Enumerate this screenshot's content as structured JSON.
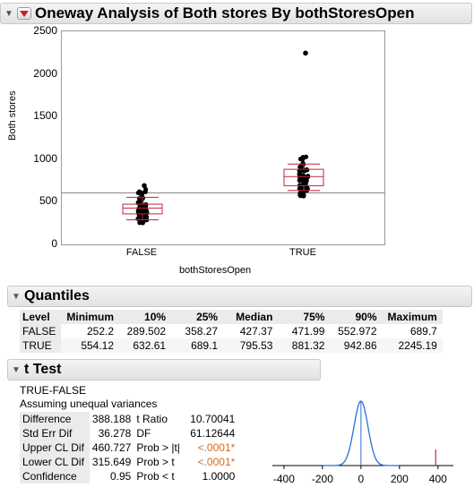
{
  "window": {
    "title": "Oneway Analysis of Both stores By bothStoresOpen"
  },
  "chart_data": {
    "type": "box",
    "title": "",
    "ylabel": "Both stores",
    "xlabel": "bothStoresOpen",
    "ylim": [
      0,
      2500
    ],
    "yticks": [
      "0",
      "500",
      "1000",
      "1500",
      "2000",
      "2500"
    ],
    "categories": [
      "FALSE",
      "TRUE"
    ],
    "grand_mean": 605,
    "boxes": [
      {
        "name": "FALSE",
        "min": 252.2,
        "q10": 289.502,
        "q1": 358.27,
        "median": 427.37,
        "q3": 471.99,
        "q90": 552.972,
        "max": 689.7
      },
      {
        "name": "TRUE",
        "min": 554.12,
        "q10": 632.61,
        "q1": 689.1,
        "median": 795.53,
        "q3": 881.32,
        "q90": 942.86,
        "max": 2245.19
      }
    ],
    "colors": {
      "box": "#c0283c",
      "points": "#000000",
      "mean_line": "#808080"
    }
  },
  "quantiles": {
    "title": "Quantiles",
    "headers": [
      "Level",
      "Minimum",
      "10%",
      "25%",
      "Median",
      "75%",
      "90%",
      "Maximum"
    ],
    "rows": [
      [
        "FALSE",
        "252.2",
        "289.502",
        "358.27",
        "427.37",
        "471.99",
        "552.972",
        "689.7"
      ],
      [
        "TRUE",
        "554.12",
        "632.61",
        "689.1",
        "795.53",
        "881.32",
        "942.86",
        "2245.19"
      ]
    ]
  },
  "ttest": {
    "title": "t Test",
    "comparison": "TRUE-FALSE",
    "assumption": "Assuming unequal variances",
    "rows": [
      {
        "label": "Difference",
        "value": "388.188",
        "label2": "t Ratio",
        "value2": "10.70041",
        "highlight": false
      },
      {
        "label": "Std Err Dif",
        "value": "36.278",
        "label2": "DF",
        "value2": "61.12644",
        "highlight": false
      },
      {
        "label": "Upper CL Dif",
        "value": "460.727",
        "label2": "Prob > |t|",
        "value2": "<.0001*",
        "highlight": true
      },
      {
        "label": "Lower CL Dif",
        "value": "315.649",
        "label2": "Prob > t",
        "value2": "<.0001*",
        "highlight": true
      },
      {
        "label": "Confidence",
        "value": "0.95",
        "label2": "Prob < t",
        "value2": "1.0000",
        "highlight": false
      }
    ],
    "dist_ticks": [
      "-400",
      "-200",
      "0",
      "200",
      "400"
    ],
    "t_ratio": 10.70041,
    "colors": {
      "curve": "#2a6fd8",
      "marker": "#c0283c",
      "center": "#2a6fd8"
    }
  }
}
